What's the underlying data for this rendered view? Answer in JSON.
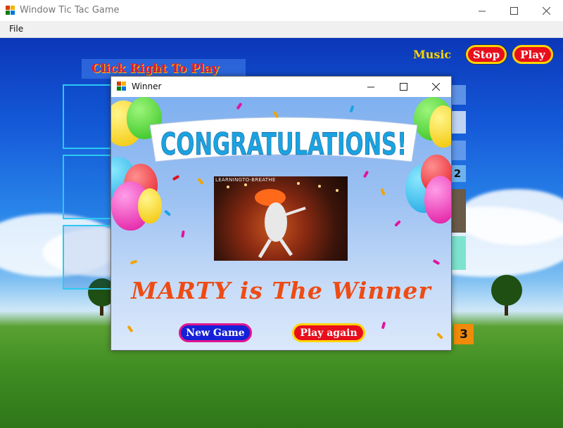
{
  "window": {
    "title": "Window Tic Tac Game"
  },
  "menu": {
    "file": "File"
  },
  "game": {
    "panel_label": "Click Right To Play",
    "music_label": "Music",
    "stop_label": "Stop",
    "play_label": "Play",
    "score_player2": "2",
    "score_count": "3"
  },
  "dialog": {
    "title": "Winner",
    "banner_text": "CONGRATULATIONS!",
    "photo_caption": "LEARNINGTO-BREATHE",
    "winner_text": "MARTY is The Winner",
    "new_game_label": "New Game",
    "play_again_label": "Play again"
  },
  "colors": {
    "button_red": "#e80e1c",
    "button_yellow_border": "#ffd400",
    "new_game_blue": "#1520d8",
    "winner_orange": "#ee4b14"
  }
}
